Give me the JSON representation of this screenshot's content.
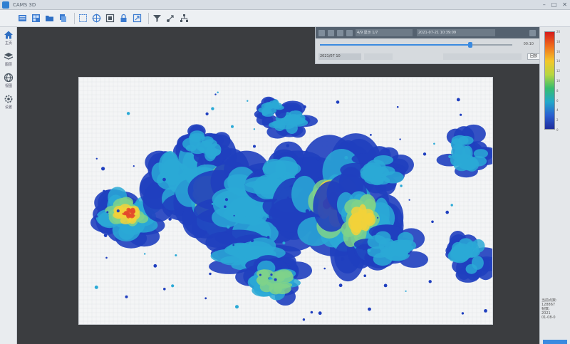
{
  "window": {
    "title": "CAMS 3D"
  },
  "toolbar": {
    "icons": [
      "layers-icon",
      "grid-icon",
      "folder-icon",
      "copy-icon",
      "select-icon",
      "target-icon",
      "frame-icon",
      "lock-icon",
      "export-icon",
      "filter-icon",
      "transform-icon",
      "tree-icon"
    ]
  },
  "sidebar": {
    "items": [
      {
        "icon": "home-icon",
        "label": "主页"
      },
      {
        "icon": "layers-icon",
        "label": "图层"
      },
      {
        "icon": "globe-icon",
        "label": "视图"
      },
      {
        "icon": "settings-icon",
        "label": "设置"
      }
    ]
  },
  "controls": {
    "field1": "4/9  显示 1/7",
    "field2": "2021-07-21 10:39:09",
    "slider_value": 0.78,
    "slider_text": "00:10",
    "field3": "2021/07 10",
    "button_label": "回放"
  },
  "colorbar": {
    "ticks": [
      "20",
      "18",
      "16",
      "14",
      "12",
      "10",
      "8",
      "6",
      "4",
      "2",
      "0"
    ],
    "colors": [
      "#d51b1b",
      "#ef6a1c",
      "#f3c72a",
      "#b6d640",
      "#36bd6e",
      "#22a8c9",
      "#2a5fd0",
      "#1f2d9c"
    ]
  },
  "stats": [
    "当前点数:",
    "128867",
    "帧数:",
    "2021",
    "01-08-0"
  ],
  "heatmap": {
    "colors": {
      "low": "#1f3fbf",
      "mid": "#2aa9d6",
      "mid2": "#7fd28a",
      "high": "#f2d23a",
      "peak": "#e4492c"
    }
  }
}
